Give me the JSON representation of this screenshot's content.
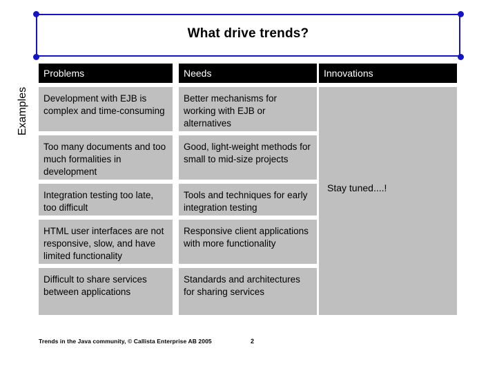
{
  "slide": {
    "title": "What drive trends?",
    "side_label": "Examples",
    "headers": [
      "Problems",
      "Needs",
      "Innovations"
    ],
    "rows": [
      {
        "problem": "Development with EJB is complex and time-consuming",
        "need": "Better mechanisms for working with EJB or alternatives"
      },
      {
        "problem": "Too many documents and too much formalities in development",
        "need": "Good, light-weight methods for small to mid-size projects"
      },
      {
        "problem": "Integration testing too late, too difficult",
        "need": "Tools and techniques for early integration testing"
      },
      {
        "problem": "HTML user interfaces are not responsive, slow, and have limited functionality",
        "need": "Responsive client applications with more functionality"
      },
      {
        "problem": "Difficult to share services between applications",
        "need": "Standards and architectures for sharing services"
      }
    ],
    "innovations_text": "Stay tuned....!",
    "footer": "Trends in the Java community, © Callista Enterprise AB 2005",
    "page_number": "2",
    "colors": {
      "frame": "#1313c8",
      "header_bg": "#000000",
      "header_text": "#ffffff",
      "cell_bg": "#bfbfbf"
    }
  }
}
